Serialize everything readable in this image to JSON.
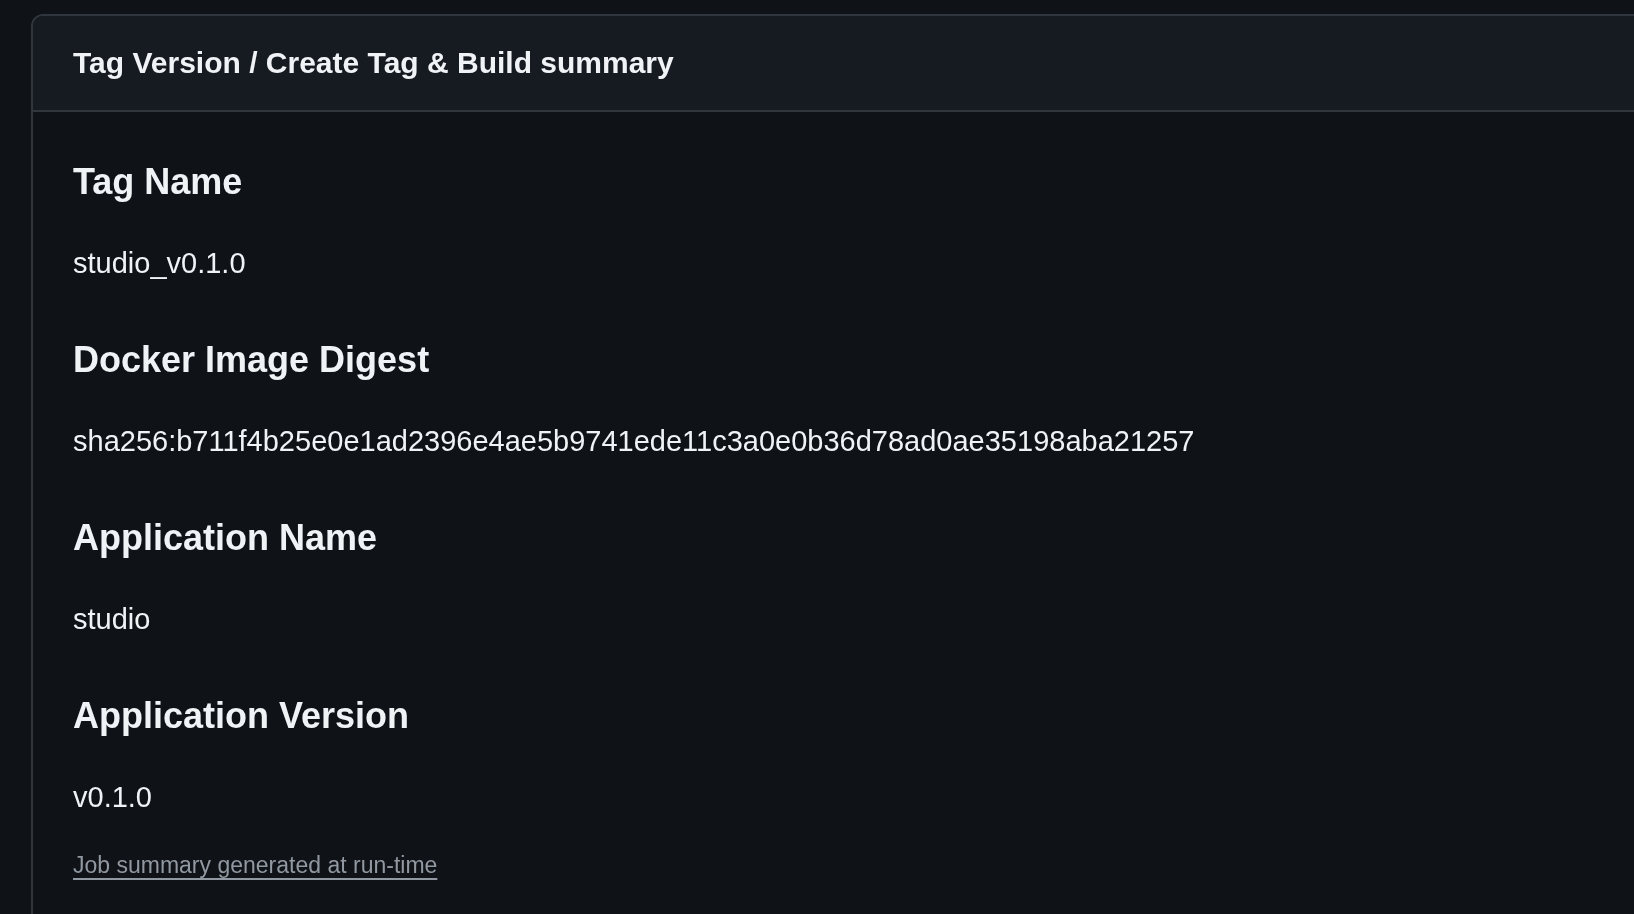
{
  "card": {
    "title": "Tag Version / Create Tag & Build summary",
    "sections": [
      {
        "heading": "Tag Name",
        "value": "studio_v0.1.0"
      },
      {
        "heading": "Docker Image Digest",
        "value": "sha256:b711f4b25e0e1ad2396e4ae5b9741ede11c3a0e0b36d78ad0ae35198aba21257"
      },
      {
        "heading": "Application Name",
        "value": "studio"
      },
      {
        "heading": "Application Version",
        "value": "v0.1.0"
      }
    ],
    "footer_link": "Job summary generated at run-time"
  }
}
